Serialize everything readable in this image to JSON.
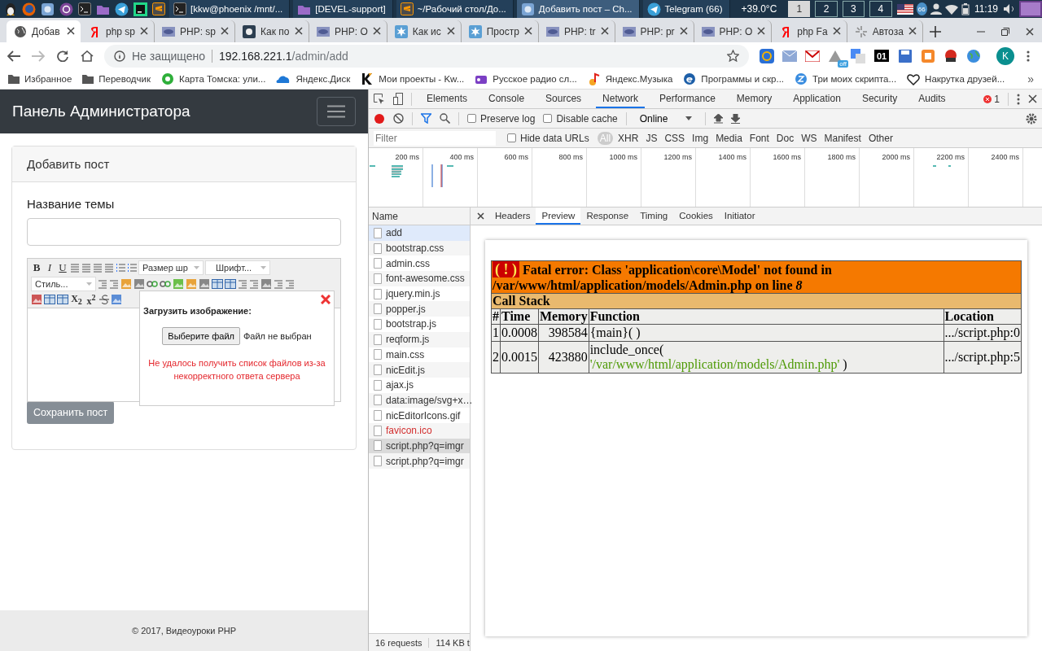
{
  "taskbar": {
    "launchers": [
      {
        "kind": "penguin"
      },
      {
        "kind": "fox"
      },
      {
        "kind": "browser"
      },
      {
        "kind": "onion"
      },
      {
        "kind": "terminal"
      },
      {
        "kind": "folder"
      },
      {
        "kind": "plane"
      },
      {
        "kind": "ide"
      },
      {
        "kind": "editor"
      }
    ],
    "windows": [
      {
        "title": "[kkw@phoenix /mnt/...",
        "kind": "terminal",
        "selected": false
      },
      {
        "title": "[DEVEL-support]",
        "kind": "folder",
        "selected": false
      },
      {
        "title": "~/Рабочий стол/До...",
        "kind": "editor",
        "selected": false
      },
      {
        "title": "Добавить пост – Ch...",
        "kind": "browser",
        "selected": true
      },
      {
        "title": "Telegram (66)",
        "kind": "plane",
        "selected": false
      }
    ],
    "temperature": "+39.0°C",
    "workspaces": [
      {
        "label": "1",
        "selected": true
      },
      {
        "label": "2",
        "selected": false
      },
      {
        "label": "3",
        "selected": false
      },
      {
        "label": "4",
        "selected": false
      }
    ],
    "tray_badge": "66",
    "clock": "11:19"
  },
  "browser": {
    "tabs": [
      {
        "title": "Добав",
        "kind": "globe",
        "selected": true
      },
      {
        "title": "php sp",
        "kind": "ya",
        "selected": false
      },
      {
        "title": "PHP: sp",
        "kind": "php",
        "selected": false
      },
      {
        "title": "Как по",
        "kind": "dark",
        "selected": false
      },
      {
        "title": "PHP: О",
        "kind": "php",
        "selected": false
      },
      {
        "title": "Как ис",
        "kind": "burst",
        "selected": false
      },
      {
        "title": "Простр",
        "kind": "burst",
        "selected": false
      },
      {
        "title": "PHP: tr",
        "kind": "php",
        "selected": false
      },
      {
        "title": "PHP: pr",
        "kind": "php",
        "selected": false
      },
      {
        "title": "PHP: O",
        "kind": "php",
        "selected": false
      },
      {
        "title": "php Fa",
        "kind": "ya",
        "selected": false
      },
      {
        "title": "Автоза",
        "kind": "spinner",
        "selected": false
      }
    ],
    "forward_disabled": true,
    "security": "Не защищено",
    "host": "192.168.221.1",
    "path": "/admin/add",
    "extensions": [
      {
        "kind": "ring"
      },
      {
        "kind": "mail"
      },
      {
        "kind": "gmail"
      },
      {
        "kind": "drive",
        "badge": "off"
      },
      {
        "kind": "translate"
      },
      {
        "kind": "counter",
        "label": "01"
      },
      {
        "kind": "disk"
      },
      {
        "kind": "square"
      },
      {
        "kind": "seo"
      },
      {
        "kind": "earth"
      }
    ],
    "avatar": "K",
    "bookmarks": [
      {
        "title": "Избранное",
        "kind": "folder"
      },
      {
        "title": "Переводчик",
        "kind": "folder"
      },
      {
        "title": "Карта Томска: ули...",
        "kind": "map"
      },
      {
        "title": "Яндекс.Диск",
        "kind": "cloud"
      },
      {
        "title": "Мои проекты - Kw...",
        "kind": "k"
      },
      {
        "title": "Русское радио сл...",
        "kind": "radio"
      },
      {
        "title": "Яндекс.Музыка",
        "kind": "note"
      },
      {
        "title": "Программы и скр...",
        "kind": "e"
      },
      {
        "title": "Три моих скрипта...",
        "kind": "z"
      },
      {
        "title": "Накрутка  друзей...",
        "kind": "heart"
      }
    ],
    "bookmarks_more": "»"
  },
  "page": {
    "brand": "Панель Администратора",
    "card_title": "Добавить пост",
    "topic_label": "Название темы",
    "editor": {
      "text_buttons": [
        {
          "label": "B",
          "kind": "bold"
        },
        {
          "label": "I",
          "kind": "italic"
        },
        {
          "label": "U",
          "kind": "underline"
        }
      ],
      "size_select": "Размер шр",
      "font_select": "Шрифт...",
      "style_select": "Стиль...",
      "script_buttons": [
        {
          "label": "X$_{2}$"
        },
        {
          "label": "x$^{2}$"
        }
      ]
    },
    "upload": {
      "title": "Загрузить изображение:",
      "file_button": "Выберите файл",
      "file_status": "Файл не выбран",
      "error": "Не удалось получить список файлов из-за некорректного ответа сервера"
    },
    "save_button": "Сохранить пост",
    "footer": "© 2017, Видеоуроки PHP"
  },
  "devtools": {
    "panels": [
      {
        "label": "Elements",
        "selected": false
      },
      {
        "label": "Console",
        "selected": false
      },
      {
        "label": "Sources",
        "selected": false
      },
      {
        "label": "Network",
        "selected": true
      },
      {
        "label": "Performance",
        "selected": false
      },
      {
        "label": "Memory",
        "selected": false
      },
      {
        "label": "Application",
        "selected": false
      },
      {
        "label": "Security",
        "selected": false
      },
      {
        "label": "Audits",
        "selected": false
      }
    ],
    "error_count": "1",
    "recording": true,
    "options": [
      {
        "label": "Preserve log",
        "checked": false
      },
      {
        "label": "Disable cache",
        "checked": false
      }
    ],
    "throttle": "Online",
    "filter_placeholder": "Filter",
    "hide_data_urls": {
      "label": "Hide data URLs",
      "checked": false
    },
    "types": [
      {
        "label": "All",
        "selected": true
      },
      {
        "label": "XHR",
        "selected": false
      },
      {
        "label": "JS",
        "selected": false
      },
      {
        "label": "CSS",
        "selected": false
      },
      {
        "label": "Img",
        "selected": false
      },
      {
        "label": "Media",
        "selected": false
      },
      {
        "label": "Font",
        "selected": false
      },
      {
        "label": "Doc",
        "selected": false
      },
      {
        "label": "WS",
        "selected": false
      },
      {
        "label": "Manifest",
        "selected": false
      },
      {
        "label": "Other",
        "selected": false
      }
    ],
    "ticks": [
      "200 ms",
      "400 ms",
      "600 ms",
      "800 ms",
      "1000 ms",
      "1200 ms",
      "1400 ms",
      "1600 ms",
      "1800 ms",
      "2000 ms",
      "2200 ms",
      "2400 ms"
    ],
    "name_header": "Name",
    "requests": [
      {
        "name": "add",
        "highlighted": true,
        "selected": false,
        "failed": false
      },
      {
        "name": "bootstrap.css",
        "highlighted": false,
        "selected": false,
        "failed": false
      },
      {
        "name": "admin.css",
        "highlighted": false,
        "selected": false,
        "failed": false
      },
      {
        "name": "font-awesome.css",
        "highlighted": false,
        "selected": false,
        "failed": false
      },
      {
        "name": "jquery.min.js",
        "highlighted": false,
        "selected": false,
        "failed": false
      },
      {
        "name": "popper.js",
        "highlighted": false,
        "selected": false,
        "failed": false
      },
      {
        "name": "bootstrap.js",
        "highlighted": false,
        "selected": false,
        "failed": false
      },
      {
        "name": "reqform.js",
        "highlighted": false,
        "selected": false,
        "failed": false
      },
      {
        "name": "main.css",
        "highlighted": false,
        "selected": false,
        "failed": false
      },
      {
        "name": "nicEdit.js",
        "highlighted": false,
        "selected": false,
        "failed": false
      },
      {
        "name": "ajax.js",
        "highlighted": false,
        "selected": false,
        "failed": false
      },
      {
        "name": "data:image/svg+x…",
        "highlighted": false,
        "selected": false,
        "failed": false
      },
      {
        "name": "nicEditorIcons.gif",
        "highlighted": false,
        "selected": false,
        "failed": false
      },
      {
        "name": "favicon.ico",
        "highlighted": false,
        "selected": false,
        "failed": true
      },
      {
        "name": "script.php?q=imgr",
        "highlighted": false,
        "selected": true,
        "failed": false
      },
      {
        "name": "script.php?q=imgr",
        "highlighted": false,
        "selected": false,
        "failed": false
      }
    ],
    "summary": [
      "16 requests",
      "114 KB t"
    ],
    "detail_tabs": [
      {
        "label": "Headers",
        "selected": false
      },
      {
        "label": "Preview",
        "selected": true
      },
      {
        "label": "Response",
        "selected": false
      },
      {
        "label": "Timing",
        "selected": false
      },
      {
        "label": "Cookies",
        "selected": false
      },
      {
        "label": "Initiator",
        "selected": false
      }
    ],
    "preview": {
      "badge": "( ! )",
      "message": "Fatal error: Class 'application\\core\\Model' not found in /var/www/html/application/models/Admin.php on line *8*",
      "stack_title": "Call Stack",
      "columns": [
        "#",
        "Time",
        "Memory",
        "Function",
        "Location"
      ],
      "rows": [
        {
          "index": "1",
          "time": "0.0008",
          "memory": "398584",
          "function": "{main}( )",
          "location": ".../script.php:0"
        },
        {
          "index": "2",
          "time": "0.0015",
          "memory": "423880",
          "function": "include_once(",
          "argument": "'/var/www/html/application/models/Admin.php'",
          "function_end": " )",
          "location": ".../script.php:5"
        }
      ]
    }
  }
}
